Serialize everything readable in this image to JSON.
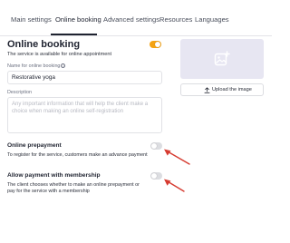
{
  "tabs": [
    {
      "label": "Main settings"
    },
    {
      "label": "Online booking"
    },
    {
      "label": "Advanced settings"
    },
    {
      "label": "Resources"
    },
    {
      "label": "Languages"
    }
  ],
  "active_tab": "Online booking",
  "section": {
    "title": "Online booking",
    "subtitle": "The service is available for online appointment",
    "enabled": true
  },
  "name_field": {
    "label": "Name for online booking",
    "value": "Restorative yoga"
  },
  "description_field": {
    "label": "Description",
    "placeholder": "Any important information that will help the client make a choice when making an online self-registration"
  },
  "image": {
    "upload_label": "Upload the image",
    "placeholder_icon": "image-add-icon"
  },
  "online_prepayment": {
    "title": "Online prepayment",
    "description": "To register for the service, customers make an advance payment",
    "enabled": false
  },
  "membership_payment": {
    "title": "Allow payment with membership",
    "description": "The client chooses whether to make an online prepayment or pay for the service with a membership",
    "enabled": false
  },
  "colors": {
    "accent": "#f5a312",
    "annotation_arrow": "#d63b30",
    "image_placeholder_bg": "#e7e6f2"
  }
}
